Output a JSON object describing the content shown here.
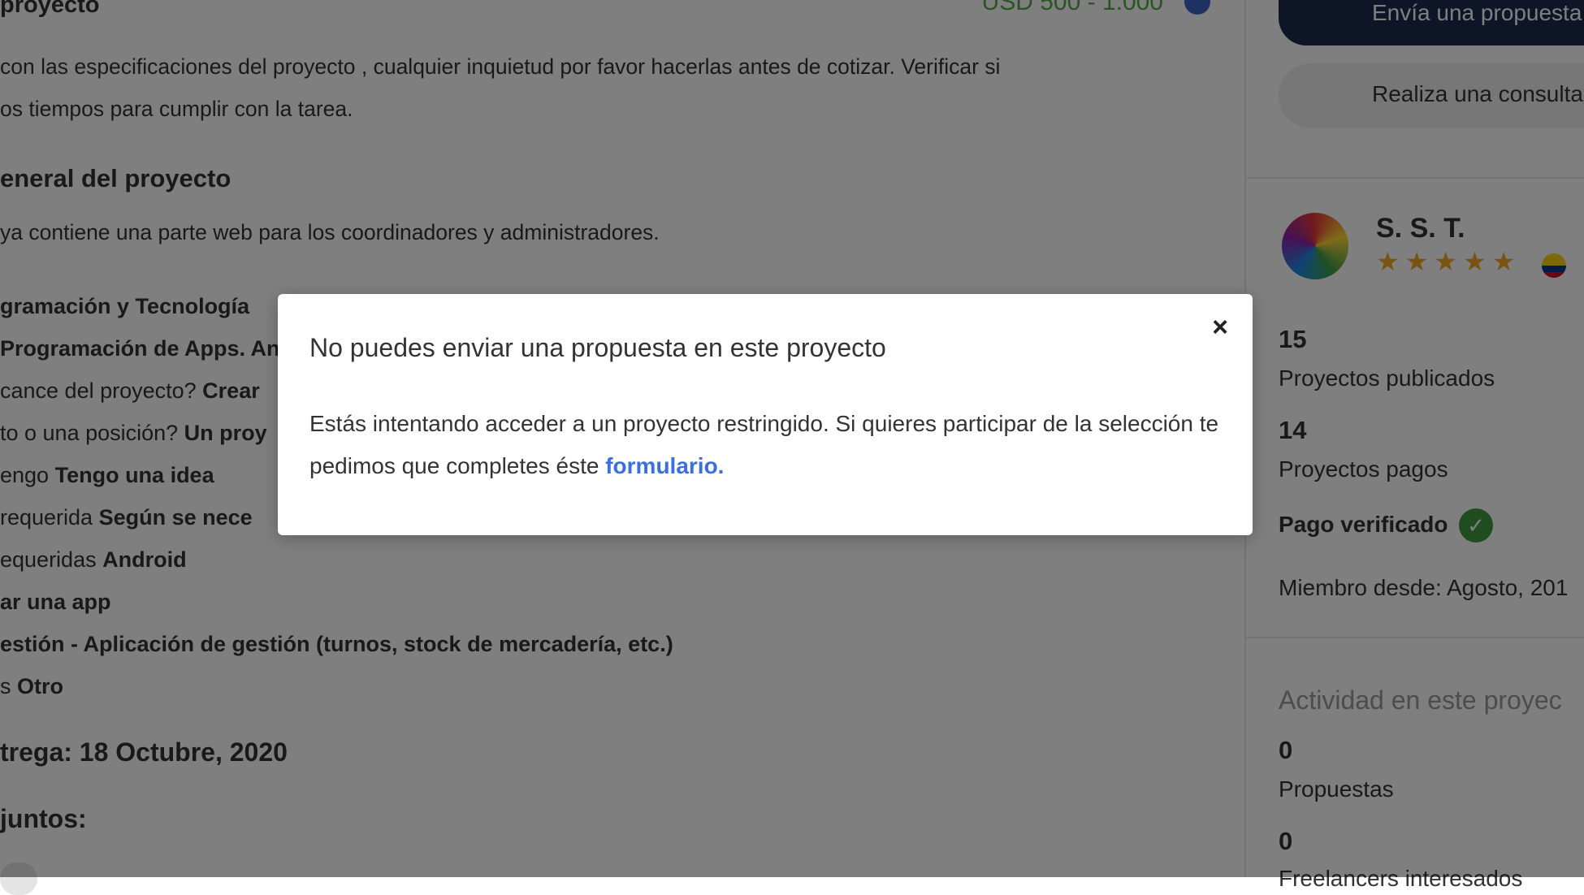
{
  "project": {
    "section_title": "proyecto",
    "price": "USD 500 - 1.000",
    "description_lines": [
      " con las especificaciones del proyecto , cualquier inquietud por favor hacerlas antes de cotizar. Verificar si",
      "os tiempos para cumplir con la tarea."
    ],
    "general_heading": "eneral del proyecto",
    "general_text": " ya contiene una parte web para los coordinadores y administradores.",
    "details": [
      {
        "label": "",
        "value": "gramación y Tecnología"
      },
      {
        "label": "",
        "value": " Programación de Apps. An"
      },
      {
        "label": "cance del proyecto? ",
        "value": "Crear"
      },
      {
        "label": "to o una posición? ",
        "value": "Un proy"
      },
      {
        "label": "engo ",
        "value": "Tengo una idea"
      },
      {
        "label": " requerida ",
        "value": "Según se nece"
      },
      {
        "label": "equeridas ",
        "value": "Android"
      },
      {
        "label": "",
        "value": "ar una app"
      },
      {
        "label": "",
        "value": "estión - Aplicación de gestión (turnos, stock de mercadería, etc.)"
      },
      {
        "label": "s ",
        "value": "Otro"
      }
    ],
    "delivery": "trega: 18 Octubre, 2020",
    "attachments": "juntos:"
  },
  "sidebar": {
    "send_proposal_label": "Envía una propuesta",
    "ask_question_label": "Realiza una consulta",
    "client_name": "S. S. T.",
    "stars": [
      "★",
      "★",
      "★",
      "★",
      "★"
    ],
    "projects_published_count": "15",
    "projects_published_label": "Proyectos publicados",
    "projects_paid_count": "14",
    "projects_paid_label": "Proyectos pagos",
    "payment_verified_label": "Pago verificado",
    "member_since": "Miembro desde: Agosto, 201",
    "activity_title": "Actividad en este proyec",
    "proposals_count": "0",
    "proposals_label": "Propuestas",
    "interested_count": "0",
    "interested_label": "Freelancers interesados"
  },
  "modal": {
    "title": "No puedes enviar una propuesta en este proyecto",
    "close": "×",
    "body_text": "Estás intentando acceder a un proyecto restringido. Si quieres participar de la selección te pedimos que completes éste ",
    "link_text": "formulario."
  },
  "colors": {
    "primary_button": "#1b2a4e",
    "price": "#56a94b",
    "link": "#3a6fe0",
    "star": "#f5a623",
    "verified": "#3e9b3f"
  }
}
